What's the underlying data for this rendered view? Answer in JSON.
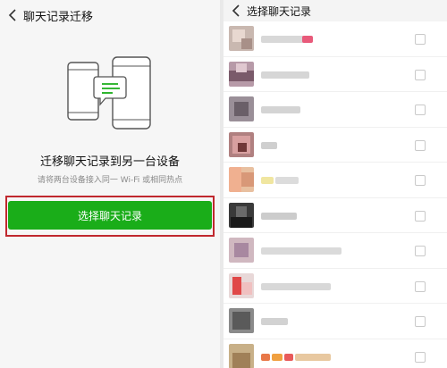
{
  "left_panel": {
    "title": "聊天记录迁移",
    "heading": "迁移聊天记录到另一台设备",
    "subtitle": "请将两台设备接入同一 Wi-Fi 或相同热点",
    "select_button": "选择聊天记录"
  },
  "right_panel": {
    "title": "选择聊天记录"
  },
  "colors": {
    "accent_green": "#1aad19",
    "highlight_red": "#c0282e"
  }
}
